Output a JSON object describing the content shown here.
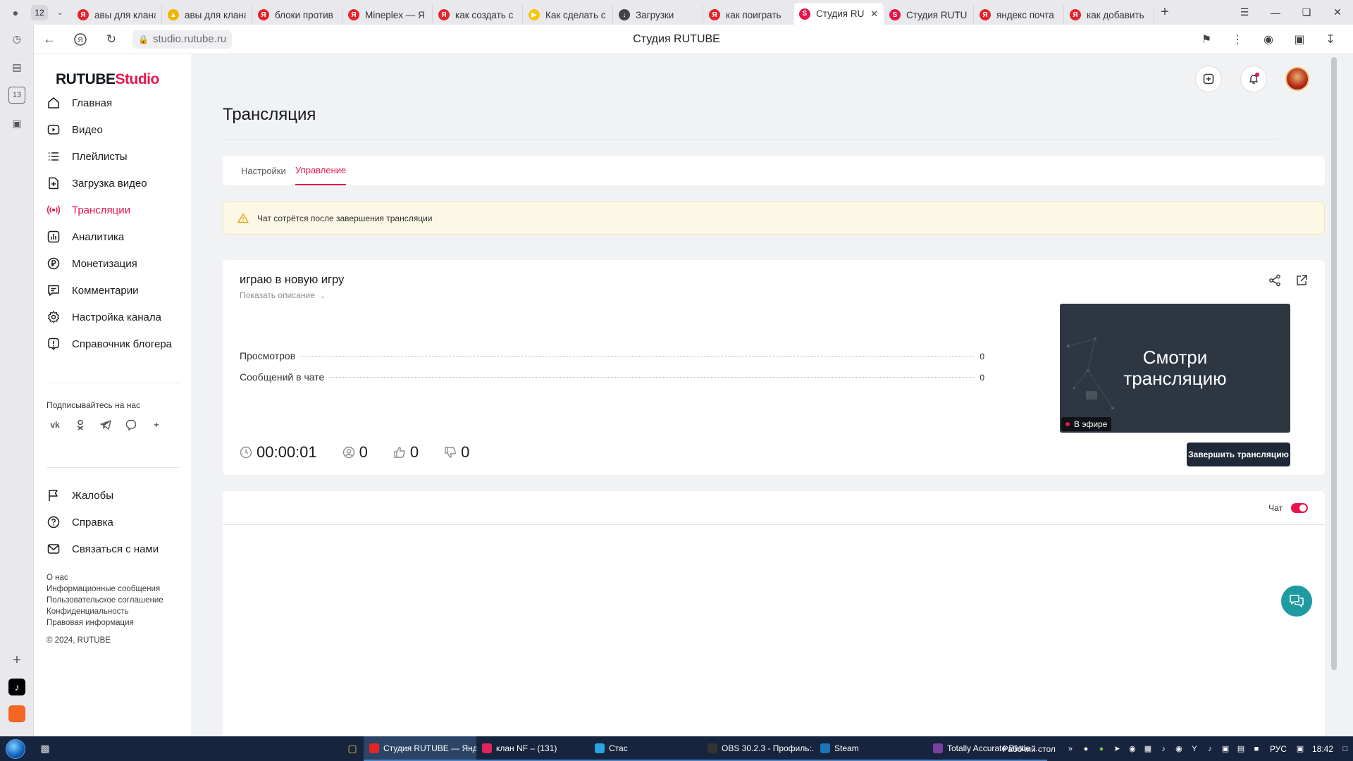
{
  "browser": {
    "tab_count": "12",
    "tabs": [
      {
        "label": "авы для клана",
        "fav_color": "#e5242a",
        "fav_glyph": "Я"
      },
      {
        "label": "авы для клана",
        "fav_color": "#f3b400",
        "fav_glyph": "▲"
      },
      {
        "label": "блоки против",
        "fav_color": "#e5242a",
        "fav_glyph": "Я"
      },
      {
        "label": "Mineplex — Я",
        "fav_color": "#e5242a",
        "fav_glyph": "Я"
      },
      {
        "label": "как создать с",
        "fav_color": "#e5242a",
        "fav_glyph": "Я"
      },
      {
        "label": "Как сделать с",
        "fav_color": "#f7c600",
        "fav_glyph": "▶"
      },
      {
        "label": "Загрузки",
        "fav_color": "#444444",
        "fav_glyph": "↓"
      },
      {
        "label": "как поиграть",
        "fav_color": "#e5242a",
        "fav_glyph": "Я"
      },
      {
        "label": "Студия RU",
        "fav_color": "#e5164d",
        "fav_glyph": "S",
        "active": true
      },
      {
        "label": "Студия RUTU",
        "fav_color": "#e5164d",
        "fav_glyph": "S"
      },
      {
        "label": "яндекс почта",
        "fav_color": "#e5242a",
        "fav_glyph": "Я"
      },
      {
        "label": "как добавить",
        "fav_color": "#e5242a",
        "fav_glyph": "Я"
      }
    ],
    "url": "studio.rutube.ru",
    "page_title": "Студия RUTUBE",
    "side_strip_number": "13"
  },
  "app": {
    "logo_main": "RUTUBE",
    "logo_studio": "Studio",
    "accent_color": "#e5164d",
    "menu": [
      {
        "label": "Главная",
        "icon": "home-icon"
      },
      {
        "label": "Видео",
        "icon": "video-icon"
      },
      {
        "label": "Плейлисты",
        "icon": "playlist-icon"
      },
      {
        "label": "Загрузка видео",
        "icon": "upload-icon"
      },
      {
        "label": "Трансляции",
        "icon": "broadcast-icon",
        "active": true
      },
      {
        "label": "Аналитика",
        "icon": "analytics-icon"
      },
      {
        "label": "Монетизация",
        "icon": "monetization-icon"
      },
      {
        "label": "Комментарии",
        "icon": "comments-icon"
      },
      {
        "label": "Настройка канала",
        "icon": "gear-icon"
      },
      {
        "label": "Справочник блогера",
        "icon": "info-icon"
      }
    ],
    "subscribe_label": "Подписывайтесь на нас",
    "socials": [
      "vk",
      "ok",
      "telegram",
      "viber",
      "plus"
    ],
    "menu2": [
      {
        "label": "Жалобы",
        "icon": "flag-icon"
      },
      {
        "label": "Справка",
        "icon": "help-icon"
      },
      {
        "label": "Связаться с нами",
        "icon": "mail-icon"
      }
    ],
    "footer_links": [
      "О нас",
      "Информационные сообщения",
      "Пользовательское соглашение",
      "Конфиденциальность",
      "Правовая информация"
    ],
    "copyright": "© 2024, RUTUBE"
  },
  "page": {
    "title": "Трансляция",
    "tabs": [
      {
        "label": "Настройки"
      },
      {
        "label": "Управление",
        "active": true
      }
    ],
    "alert_text": "Чат сотрётся после завершения трансляции",
    "stream": {
      "title": "играю в новую игру",
      "show_description": "Показать описание",
      "stats": [
        {
          "label": "Просмотров",
          "value": "0"
        },
        {
          "label": "Сообщений в чате",
          "value": "0"
        }
      ],
      "duration": "00:00:01",
      "viewers": "0",
      "likes": "0",
      "dislikes": "0",
      "preview_text_line1": "Смотри",
      "preview_text_line2": "трансляцию",
      "live_badge": "В эфире",
      "end_button": "Завершить трансляцию"
    },
    "chat_label": "Чат",
    "chat_enabled": true
  },
  "taskbar": {
    "items": [
      {
        "label": "Студия RUTUBE — Янд...",
        "color": "#e5242a",
        "active": true
      },
      {
        "label": "клан NF – (131)",
        "color": "#e0245e"
      },
      {
        "label": "Стас",
        "color": "#2aa3e0"
      },
      {
        "label": "OBS 30.2.3 - Профиль:...",
        "color": "#333333"
      },
      {
        "label": "Steam",
        "color": "#1b75bb"
      },
      {
        "label": "Totally Accurate Battle ...",
        "color": "#7b3fa0"
      }
    ],
    "desktop_label": "Рабочий стол",
    "lang": "РУС",
    "time": "18:42"
  }
}
